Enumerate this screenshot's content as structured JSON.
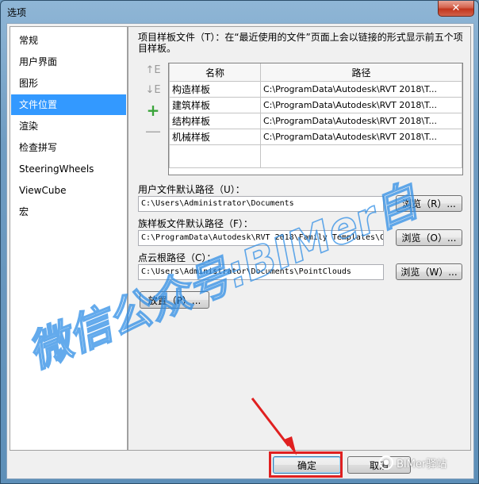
{
  "window": {
    "title": "选项",
    "close_glyph": "✕"
  },
  "sidebar": {
    "items": [
      {
        "label": "常规",
        "selected": false
      },
      {
        "label": "用户界面",
        "selected": false
      },
      {
        "label": "图形",
        "selected": false
      },
      {
        "label": "文件位置",
        "selected": true
      },
      {
        "label": "渲染",
        "selected": false
      },
      {
        "label": "检查拼写",
        "selected": false
      },
      {
        "label": "SteeringWheels",
        "selected": false
      },
      {
        "label": "ViewCube",
        "selected": false
      },
      {
        "label": "宏",
        "selected": false
      }
    ]
  },
  "panel": {
    "description": "项目样板文件（T）：在“最近使用的文件”页面上会以链接的形式显示前五个项目样板。",
    "icons": {
      "move_up": "↑E",
      "move_down": "↓E",
      "add": "+",
      "remove": "—"
    },
    "table": {
      "headers": [
        "名称",
        "路径"
      ],
      "rows": [
        {
          "name": "构造样板",
          "path": "C:\\ProgramData\\Autodesk\\RVT 2018\\T..."
        },
        {
          "name": "建筑样板",
          "path": "C:\\ProgramData\\Autodesk\\RVT 2018\\T..."
        },
        {
          "name": "结构样板",
          "path": "C:\\ProgramData\\Autodesk\\RVT 2018\\T..."
        },
        {
          "name": "机械样板",
          "path": "C:\\ProgramData\\Autodesk\\RVT 2018\\T..."
        }
      ]
    },
    "user_path": {
      "label": "用户文件默认路径（U）：",
      "value": "C:\\Users\\Administrator\\Documents",
      "browse": "浏览（R）..."
    },
    "family_path": {
      "label": "族样板文件默认路径（F）：",
      "value": "C:\\ProgramData\\Autodesk\\RVT 2018\\Family Templates\\C",
      "browse": "浏览（O）..."
    },
    "cloud_path": {
      "label": "点云根路径（C）：",
      "value": "C:\\Users\\Administrator\\Documents\\PointClouds",
      "browse": "浏览（W）..."
    },
    "places_button": "放置（P）..."
  },
  "footer": {
    "ok": "确定",
    "cancel": "取消"
  },
  "watermark": {
    "text": "微信公众号:BIMer自",
    "badge": "BIMer驿站"
  },
  "colors": {
    "selection": "#3399ff",
    "highlight": "#e02020",
    "watermark": "#2f8ee6"
  }
}
